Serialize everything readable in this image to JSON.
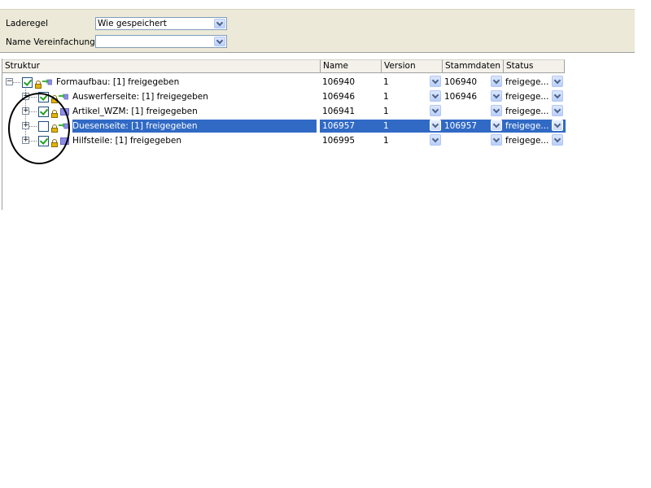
{
  "options": {
    "laderegel_label": "Laderegel",
    "laderegel_value": "Wie gespeichert",
    "name_vereinfachung_label": "Name Vereinfachung",
    "name_vereinfachung_value": ""
  },
  "columns": [
    "Struktur",
    "Name",
    "Version",
    "Stammdaten",
    "Status"
  ],
  "rows": [
    {
      "label": "Formaufbau: [1] freigegeben",
      "name": "106940",
      "version": "1",
      "stammdaten": "106940",
      "status": "freigege...",
      "checked": true,
      "selected": false
    },
    {
      "label": "Auswerferseite: [1] freigegeben",
      "name": "106946",
      "version": "1",
      "stammdaten": "106946",
      "status": "freigege...",
      "checked": true,
      "selected": false
    },
    {
      "label": "Artikel_WZM: [1] freigegeben",
      "name": "106941",
      "version": "1",
      "stammdaten": "",
      "status": "freigege...",
      "checked": true,
      "selected": false
    },
    {
      "label": "Duesenseite: [1] freigegeben",
      "name": "106957",
      "version": "1",
      "stammdaten": "106957",
      "status": "freigege...",
      "checked": false,
      "selected": true
    },
    {
      "label": "Hilfsteile: [1] freigegeben",
      "name": "106995",
      "version": "1",
      "stammdaten": "",
      "status": "freigege...",
      "checked": true,
      "selected": false
    }
  ],
  "icons": {
    "collapse": "minus-expander-icon",
    "expand": "plus-expander-icon",
    "checkbox": "checkbox-icon",
    "lock": "lock-icon",
    "assembly": "assembly-arrows-icon",
    "part": "part-block-icon",
    "dropdown": "chevron-down-icon"
  },
  "colors": {
    "panel_bg": "#ece9d8",
    "selection": "#316ac5",
    "check_green": "#21a121",
    "lock_yellow": "#e3b400"
  }
}
